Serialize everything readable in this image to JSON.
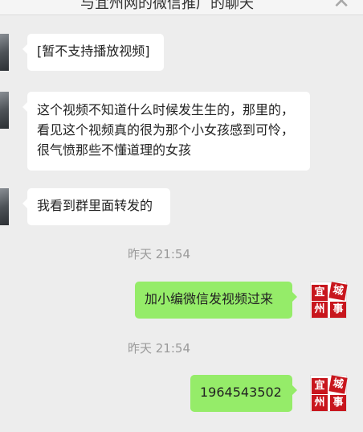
{
  "header": {
    "title": "与宜州网的微信推广的聊天",
    "close_icon": "close-icon"
  },
  "messages": [
    {
      "side": "left",
      "text": "[暂不支持播放视频]"
    },
    {
      "side": "left",
      "text": "这个视频不知道什么时候发生生的，那里的，看见这个视频真的很为那个小女孩感到可怜，很气愤那些不懂道理的女孩"
    },
    {
      "side": "left",
      "text": "我看到群里面转发的"
    },
    {
      "side": "time",
      "text": "昨天 21:54"
    },
    {
      "side": "right",
      "text": "加小编微信发视频过来"
    },
    {
      "side": "time",
      "text": "昨天 21:54"
    },
    {
      "side": "right",
      "text": "1964543502"
    }
  ],
  "avatar_right_logo": [
    "宜",
    "城",
    "州",
    "事"
  ],
  "colors": {
    "background": "#ededed",
    "bubble_left": "#ffffff",
    "bubble_right": "#95ec69",
    "logo_red": "#c8161d"
  }
}
